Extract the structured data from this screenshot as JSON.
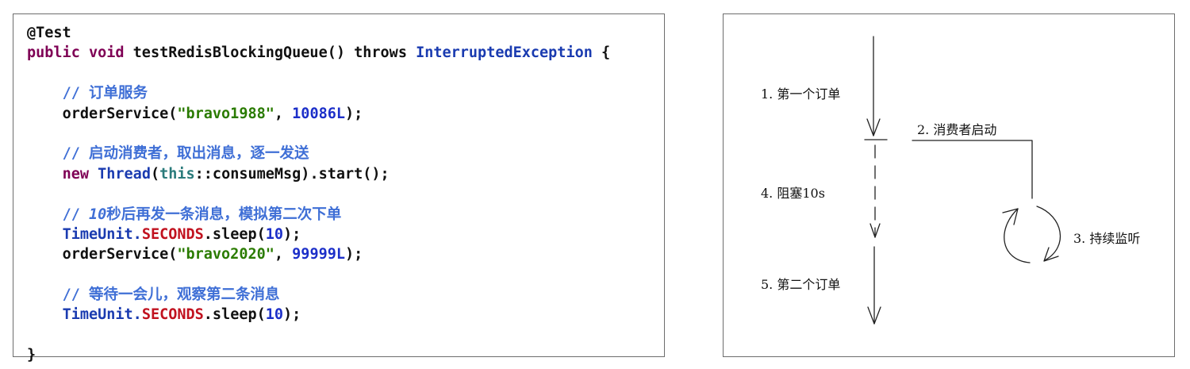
{
  "code": {
    "l1_annotation": "@Test",
    "l2_public": "public",
    "l2_void": "void",
    "l2_method": "testRedisBlockingQueue()",
    "l2_throws": "throws",
    "l2_exception": "InterruptedException",
    "l2_brace": "{",
    "l4_comment": "// 订单服务",
    "l5_call": "orderService(",
    "l5_str": "\"bravo1988\"",
    "l5_sep": ", ",
    "l5_num": "10086L",
    "l5_end": ");",
    "l7_comment": "// 启动消费者，取出消息，逐一发送",
    "l8_new": "new",
    "l8_thread": "Thread",
    "l8_paren": "(",
    "l8_this": "this",
    "l8_rest": "::consumeMsg).start();",
    "l10_comment_pre": "// ",
    "l10_comment_num": "10",
    "l10_comment_post": "秒后再发一条消息，模拟第二次下单",
    "l11_timeunit": "TimeUnit.",
    "l11_seconds": "SECONDS",
    "l11_sleep": ".sleep(",
    "l11_num": "10",
    "l11_end": ");",
    "l12_call": "orderService(",
    "l12_str": "\"bravo2020\"",
    "l12_sep": ", ",
    "l12_num": "99999L",
    "l12_end": ");",
    "l14_comment": "// 等待一会儿，观察第二条消息",
    "l15_timeunit": "TimeUnit.",
    "l15_seconds": "SECONDS",
    "l15_sleep": ".sleep(",
    "l15_num": "10",
    "l15_end": ");",
    "l17_brace": "}"
  },
  "diagram": {
    "step1": "1. 第一个订单",
    "step2": "2. 消费者启动",
    "step3": "3. 持续监听",
    "step4": "4. 阻塞10s",
    "step5": "5. 第二个订单"
  }
}
